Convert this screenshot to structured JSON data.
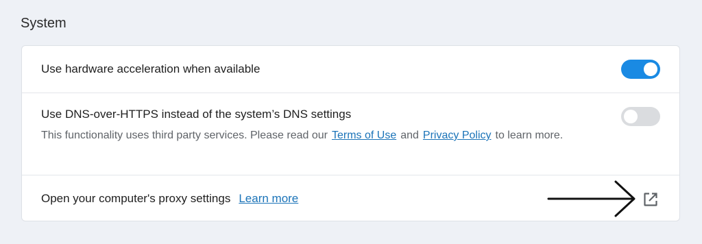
{
  "section": {
    "title": "System"
  },
  "settings": {
    "hardware_acceleration": {
      "label": "Use hardware acceleration when available",
      "enabled": true
    },
    "dns_over_https": {
      "label": "Use DNS-over-HTTPS instead of the system’s DNS settings",
      "description_before": "This functionality uses third party services. Please read our",
      "terms_link": "Terms of Use",
      "description_and": "and",
      "privacy_link": "Privacy Policy",
      "description_after": "to learn more.",
      "enabled": false
    },
    "proxy": {
      "label": "Open your computer's proxy settings",
      "learn_more_link": "Learn more"
    }
  },
  "colors": {
    "toggle_on": "#1a8ae3",
    "toggle_off": "#dadcdf",
    "link": "#1a73b8"
  },
  "icons": {
    "external_link": "open-in-new-icon",
    "annotation": "arrow-right-icon"
  }
}
